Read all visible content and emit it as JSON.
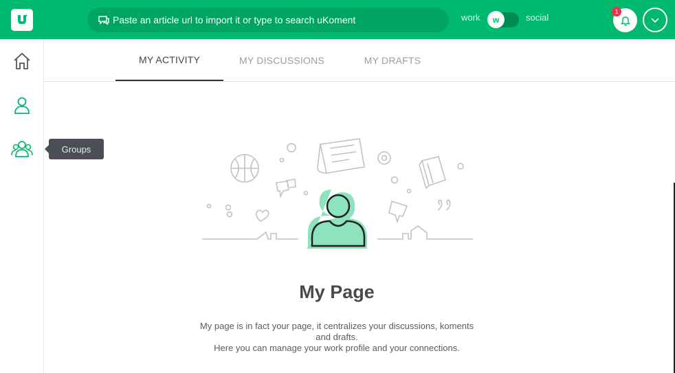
{
  "header": {
    "search_placeholder": "Paste an article url to import it or type to search uKoment",
    "mode_left": "work",
    "mode_right": "social",
    "toggle_value": "w",
    "notification_count": "1"
  },
  "sidebar": {
    "items": [
      {
        "name": "home"
      },
      {
        "name": "profile"
      },
      {
        "name": "groups"
      }
    ],
    "tooltip": "Groups"
  },
  "tabs": [
    {
      "label": "MY ACTIVITY",
      "active": true
    },
    {
      "label": "MY DISCUSSIONS",
      "active": false
    },
    {
      "label": "MY DRAFTS",
      "active": false
    }
  ],
  "main": {
    "title": "My Page",
    "description_line1": "My page is in fact your page, it centralizes your discussions, koments",
    "description_line2": "and drafts.",
    "description_line3": "Here you can manage your work profile and your connections."
  },
  "colors": {
    "brand": "#00b96f",
    "accent_light": "#8ee3bf",
    "badge": "#f0334b"
  }
}
